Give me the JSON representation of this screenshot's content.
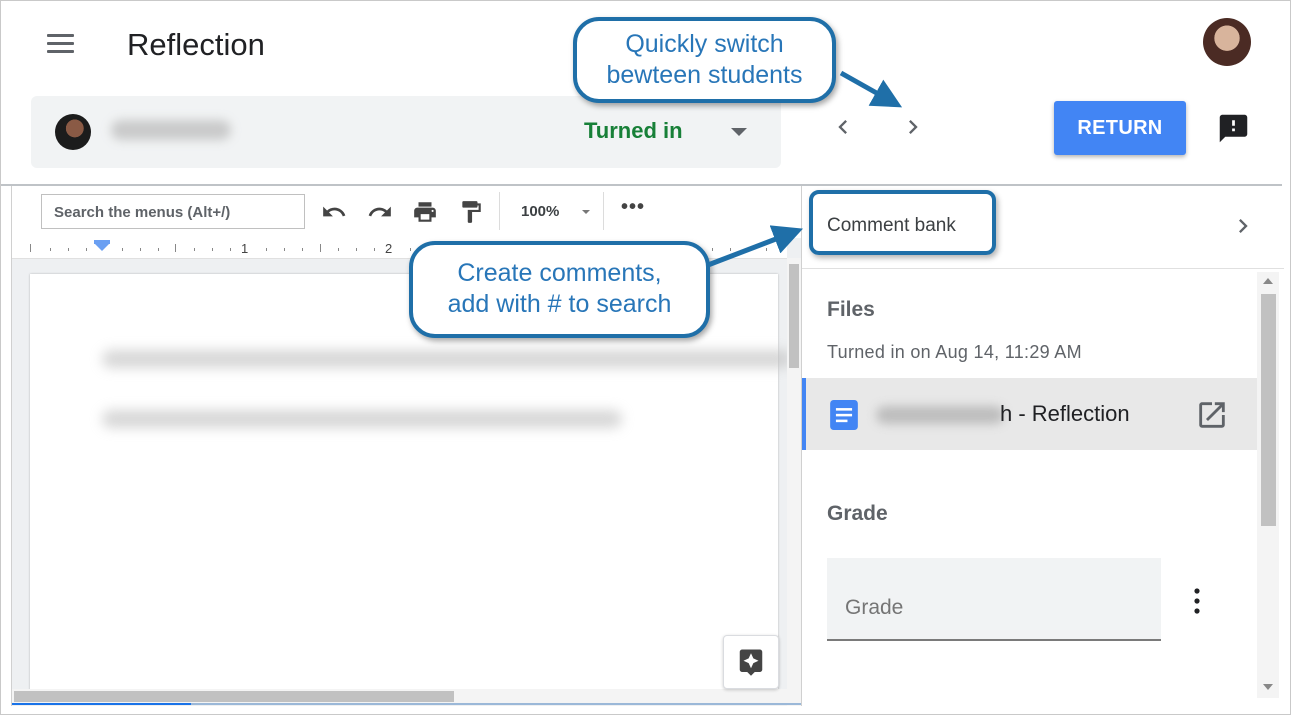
{
  "header": {
    "title": "Reflection"
  },
  "student": {
    "status": "Turned in"
  },
  "actions": {
    "return_label": "RETURN"
  },
  "doc": {
    "search_placeholder": "Search the menus (Alt+/)",
    "zoom": "100%",
    "more": "•••",
    "ruler_numbers": [
      "1",
      "2"
    ]
  },
  "panel": {
    "comment_bank_label": "Comment bank",
    "files_heading": "Files",
    "turned_in_date": "Turned in on Aug 14, 11:29 AM",
    "file_name_suffix": "h - Reflection",
    "grade_heading": "Grade",
    "grade_placeholder": "Grade"
  },
  "callouts": {
    "switch_line1": "Quickly switch",
    "switch_line2": "bewteen students",
    "create_line1": "Create comments,",
    "create_line2": "add with # to search"
  },
  "colors": {
    "status_green": "#188038",
    "return_blue": "#4285f4",
    "callout_border": "#1f6fa8",
    "callout_text": "#2876b8"
  }
}
